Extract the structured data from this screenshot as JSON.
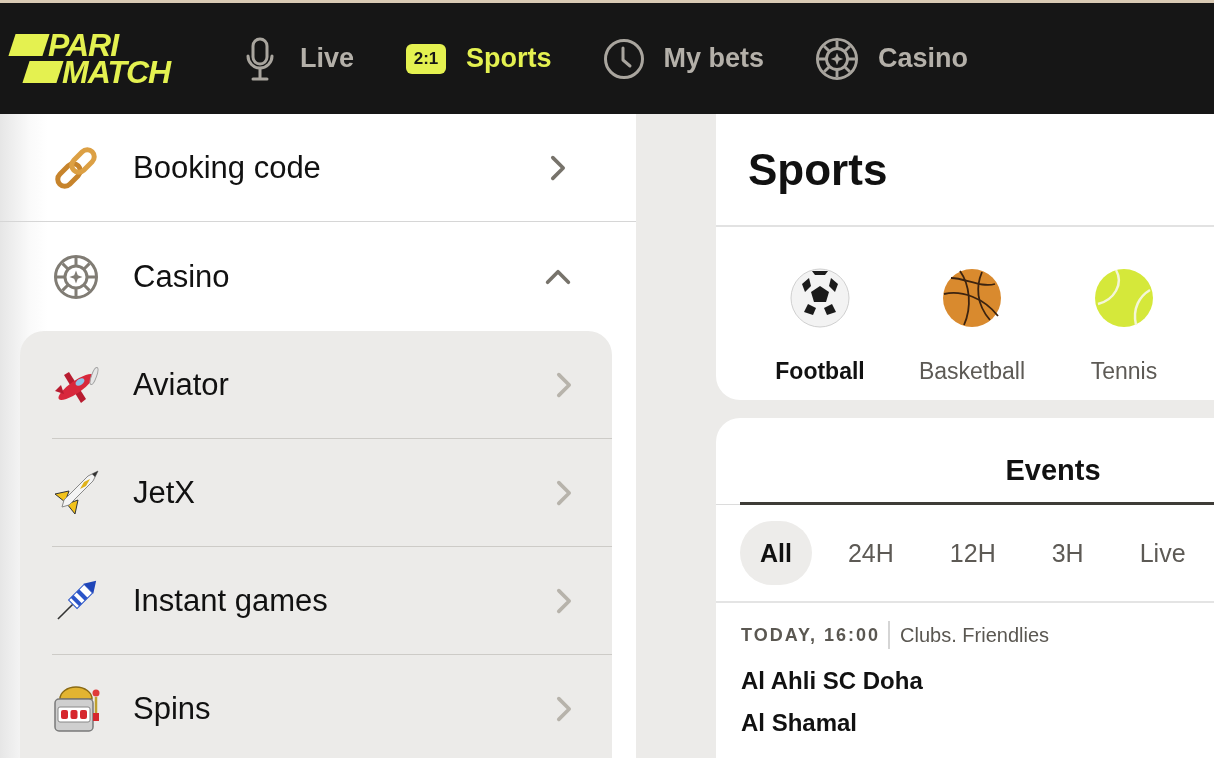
{
  "header": {
    "logo": {
      "lines": [
        "PARI",
        "MATCH"
      ]
    },
    "nav": [
      {
        "label": "Live",
        "selected": false
      },
      {
        "label": "Sports",
        "badge": "2:1",
        "selected": true
      },
      {
        "label": "My bets",
        "selected": false
      },
      {
        "label": "Casino",
        "selected": false
      }
    ]
  },
  "sidebar": {
    "items": [
      {
        "label": "Booking code",
        "kind": "link"
      },
      {
        "label": "Casino",
        "kind": "group",
        "expanded": true,
        "children": [
          {
            "label": "Aviator"
          },
          {
            "label": "JetX"
          },
          {
            "label": "Instant games"
          },
          {
            "label": "Spins"
          }
        ]
      }
    ]
  },
  "sports_panel": {
    "title": "Sports",
    "sports": [
      {
        "label": "Football",
        "selected": true
      },
      {
        "label": "Basketball",
        "selected": false
      },
      {
        "label": "Tennis",
        "selected": false
      }
    ]
  },
  "events_panel": {
    "tabs": [
      {
        "label": "Events",
        "selected": true
      }
    ],
    "filters": [
      {
        "label": "All",
        "selected": true
      },
      {
        "label": "24H",
        "selected": false
      },
      {
        "label": "12H",
        "selected": false
      },
      {
        "label": "3H",
        "selected": false
      },
      {
        "label": "Live",
        "selected": false
      }
    ],
    "events": [
      {
        "time": "TODAY, 16:00",
        "league": "Clubs. Friendlies",
        "teams": [
          "Al Ahli SC Doha",
          "Al Shamal"
        ]
      }
    ]
  }
}
